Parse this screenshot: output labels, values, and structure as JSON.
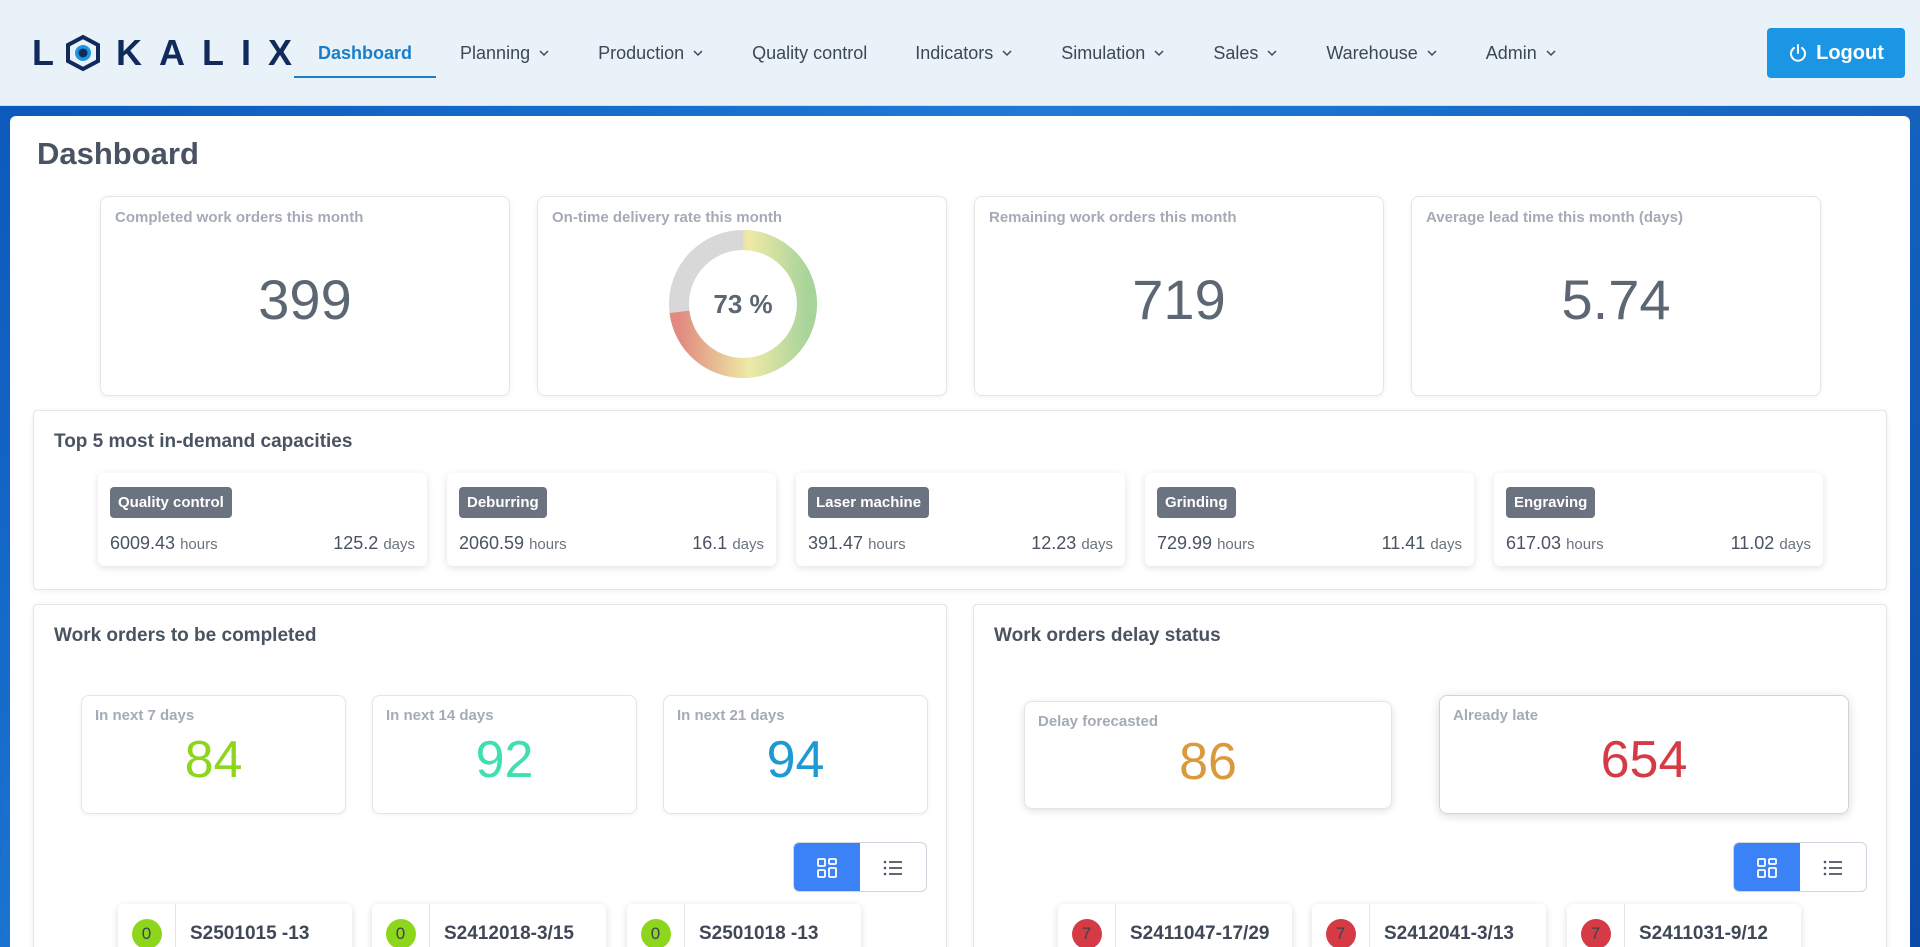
{
  "brand": {
    "logo_text": "LOKALIX"
  },
  "nav": {
    "items": [
      {
        "label": "Dashboard",
        "active": true,
        "dropdown": false
      },
      {
        "label": "Planning",
        "dropdown": true
      },
      {
        "label": "Production",
        "dropdown": true
      },
      {
        "label": "Quality control",
        "dropdown": false
      },
      {
        "label": "Indicators",
        "dropdown": true
      },
      {
        "label": "Simulation",
        "dropdown": true
      },
      {
        "label": "Sales",
        "dropdown": true
      },
      {
        "label": "Warehouse",
        "dropdown": true
      },
      {
        "label": "Admin",
        "dropdown": true
      }
    ],
    "logout_label": "Logout",
    "logout_icon": "power-icon"
  },
  "page": {
    "title": "Dashboard"
  },
  "kpis": {
    "completed": {
      "label": "Completed work orders this month",
      "value": "399"
    },
    "ontime": {
      "label": "On-time delivery rate this month",
      "value_text": "73 %",
      "percent": 73
    },
    "remaining": {
      "label": "Remaining work orders this month",
      "value": "719"
    },
    "leadtime": {
      "label": "Average lead time this month (days)",
      "value": "5.74"
    }
  },
  "capacities": {
    "title": "Top 5 most in-demand capacities",
    "hours_unit": "hours",
    "days_unit": "days",
    "items": [
      {
        "name": "Quality control",
        "hours": "6009.43",
        "days": "125.2"
      },
      {
        "name": "Deburring",
        "hours": "2060.59",
        "days": "16.1"
      },
      {
        "name": "Laser machine",
        "hours": "391.47",
        "days": "12.23"
      },
      {
        "name": "Grinding",
        "hours": "729.99",
        "days": "11.41"
      },
      {
        "name": "Engraving",
        "hours": "617.03",
        "days": "11.02"
      }
    ]
  },
  "to_complete": {
    "title": "Work orders to be completed",
    "next7": {
      "label": "In next 7 days",
      "value": "84",
      "color": "#8ed61c"
    },
    "next14": {
      "label": "In next 14 days",
      "value": "92",
      "color": "#3ee0b0"
    },
    "next21": {
      "label": "In next 21 days",
      "value": "94",
      "color": "#1b9ad6"
    },
    "orders": [
      {
        "count": "0",
        "id": "S2501015 -13"
      },
      {
        "count": "0",
        "id": "S2412018-3/15"
      },
      {
        "count": "0",
        "id": "S2501018 -13"
      }
    ],
    "count_color": "#8ed61c"
  },
  "delay": {
    "title": "Work orders delay status",
    "forecast": {
      "label": "Delay forecasted",
      "value": "86",
      "color": "#d99a3e"
    },
    "late": {
      "label": "Already late",
      "value": "654",
      "color": "#d63a44"
    },
    "orders": [
      {
        "count": "7",
        "id": "S2411047-17/29"
      },
      {
        "count": "7",
        "id": "S2412041-3/13"
      },
      {
        "count": "7",
        "id": "S2411031-9/12"
      }
    ],
    "count_color": "#d63a44"
  },
  "view_toggle": {
    "grid_icon": "grid-view-icon",
    "list_icon": "list-view-icon"
  }
}
